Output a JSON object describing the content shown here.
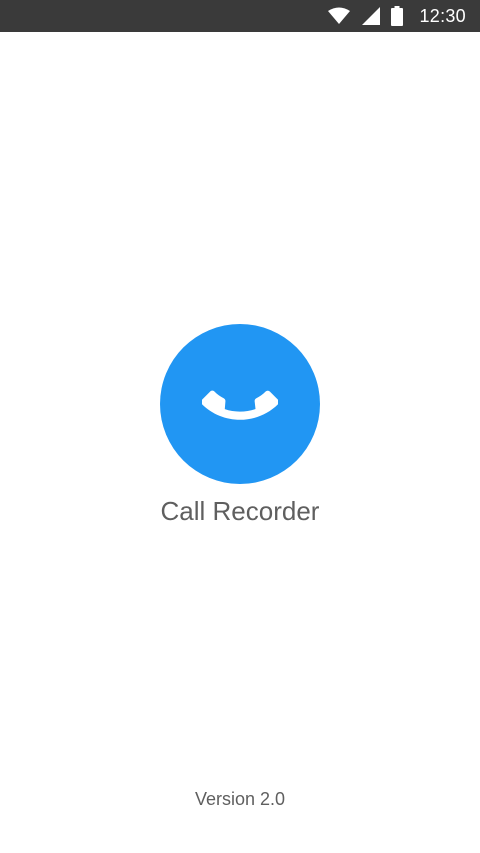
{
  "status_bar": {
    "time": "12:30",
    "icons": [
      "wifi-icon",
      "signal-icon",
      "battery-icon"
    ],
    "background": "#3a3a3a"
  },
  "splash": {
    "app_name": "Call Recorder",
    "version": "Version 2.0",
    "logo_icon": "phone-handset-icon",
    "accent_color": "#2196f3"
  }
}
